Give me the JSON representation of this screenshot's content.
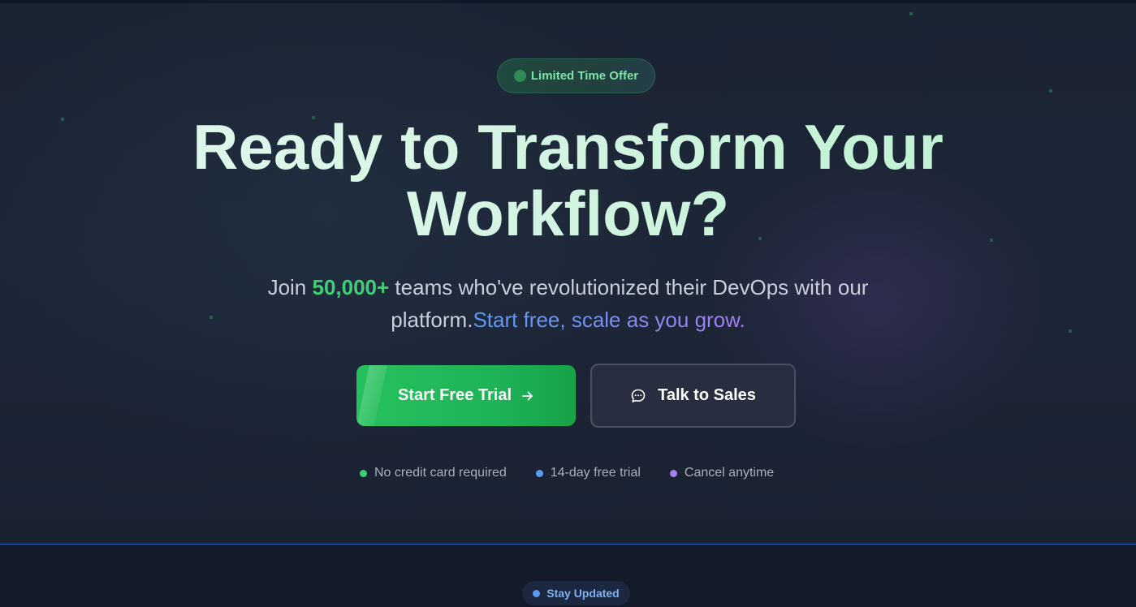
{
  "badge": {
    "label": "Limited Time Offer"
  },
  "headline": {
    "line1": "Ready to Transform Your",
    "line2": "Workflow?"
  },
  "subtitle": {
    "prefix": "Join ",
    "highlight": "50,000+",
    "middle": " teams who've revolutionized their DevOps with our platform.",
    "gradient_text": "Start free, scale as you grow."
  },
  "buttons": {
    "primary": {
      "label": "Start Free Trial",
      "icon": "arrow-right-icon"
    },
    "secondary": {
      "label": "Talk to Sales",
      "icon": "chat-bubble-icon"
    }
  },
  "features": [
    {
      "label": "No credit card required",
      "color": "#3fce74"
    },
    {
      "label": "14-day free trial",
      "color": "#5b9bf0"
    },
    {
      "label": "Cancel anytime",
      "color": "#a57ef0"
    }
  ],
  "next_section": {
    "pill_label": "Stay Updated"
  },
  "colors": {
    "accent_green": "#22c55e",
    "accent_blue": "#5b9bf0",
    "accent_purple": "#a57ef0",
    "background": "#1b2433"
  }
}
